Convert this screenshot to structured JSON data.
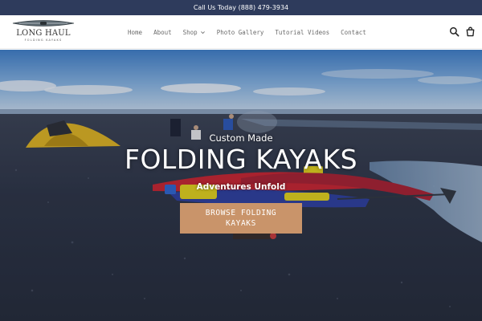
{
  "announcement": {
    "text": "Call Us Today (888) 479-3934"
  },
  "brand": {
    "name": "LONG HAUL",
    "tagline": "FOLDING KAYAKS"
  },
  "nav": {
    "items": [
      {
        "label": "Home"
      },
      {
        "label": "About"
      },
      {
        "label": "Shop"
      },
      {
        "label": "Photo Gallery"
      },
      {
        "label": "Tutorial Videos"
      },
      {
        "label": "Contact"
      }
    ]
  },
  "header_icons": [
    "search-icon",
    "cart-icon"
  ],
  "hero": {
    "kicker": "Custom Made",
    "title": "FOLDING KAYAKS",
    "subtitle": "Adventures Unfold",
    "cta_label": "BROWSE FOLDING KAYAKS"
  },
  "colors": {
    "announcement_bg": "#2e3b5c",
    "button_bg": "#c9946a",
    "nav_text": "#6b6b6b"
  }
}
